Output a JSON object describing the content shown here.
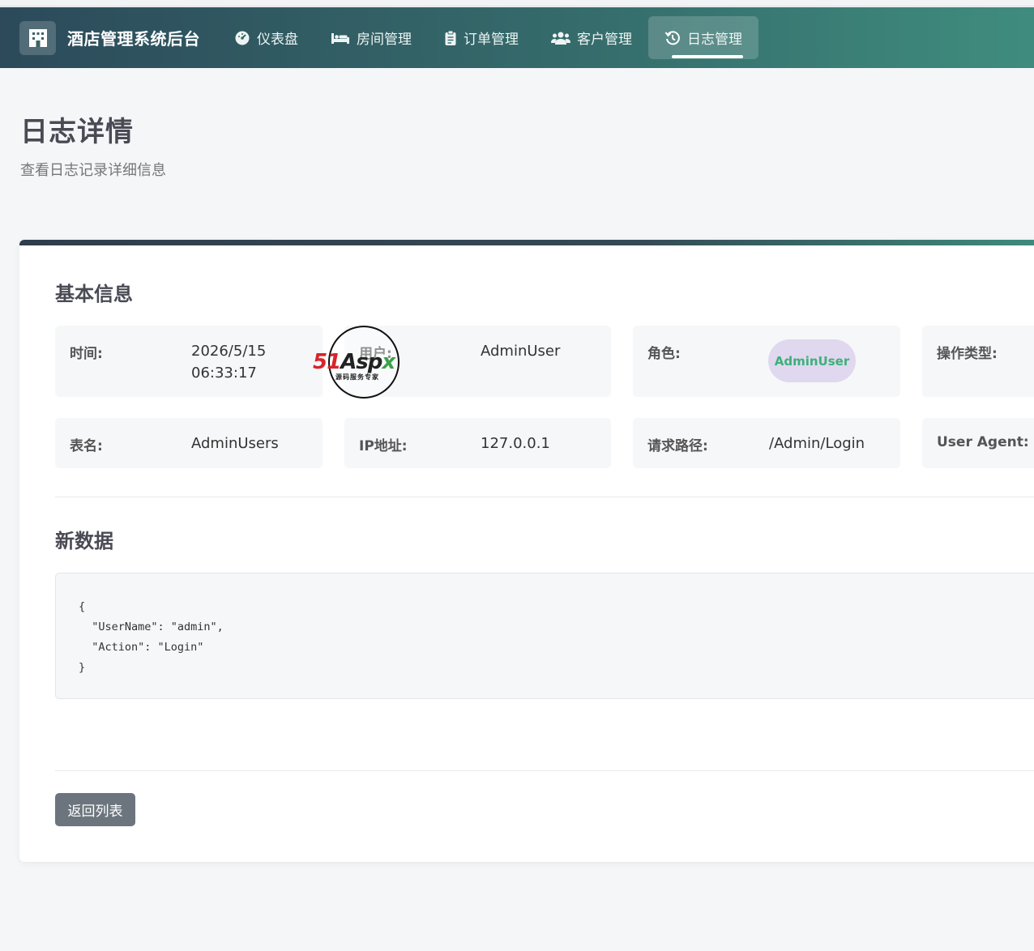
{
  "app": {
    "title": "酒店管理系统后台"
  },
  "nav": {
    "items": [
      {
        "label": "仪表盘",
        "icon": "dashboard-icon"
      },
      {
        "label": "房间管理",
        "icon": "bed-icon"
      },
      {
        "label": "订单管理",
        "icon": "clipboard-icon"
      },
      {
        "label": "客户管理",
        "icon": "users-icon"
      },
      {
        "label": "日志管理",
        "icon": "history-icon",
        "active": true
      }
    ]
  },
  "page": {
    "title": "日志详情",
    "subtitle": "查看日志记录详细信息"
  },
  "basic_info": {
    "title": "基本信息",
    "time_label": "时间:",
    "time_date": "2026/5/15",
    "time_clock": "06:33:17",
    "user_label": "用户:",
    "user_value": "AdminUser",
    "role_label": "角色:",
    "role_value": "AdminUser",
    "op_type_label": "操作类型:",
    "table_label": "表名:",
    "table_value": "AdminUsers",
    "ip_label": "IP地址:",
    "ip_value": "127.0.0.1",
    "path_label": "请求路径:",
    "path_value": "/Admin/Login",
    "ua_label": "User Agent:"
  },
  "new_data": {
    "title": "新数据",
    "json_text": "{\n  \"UserName\": \"admin\",\n  \"Action\": \"Login\"\n}"
  },
  "actions": {
    "back_label": "返回列表"
  },
  "watermark": {
    "brand": "51Aspx",
    "tagline": "源码服务专家"
  },
  "colors": {
    "nav_start": "#2c4a5a",
    "nav_end": "#3f8c7e",
    "role_badge_bg": "#e0d8ef",
    "role_badge_text": "#3cb07a",
    "back_button": "#6c757d"
  }
}
